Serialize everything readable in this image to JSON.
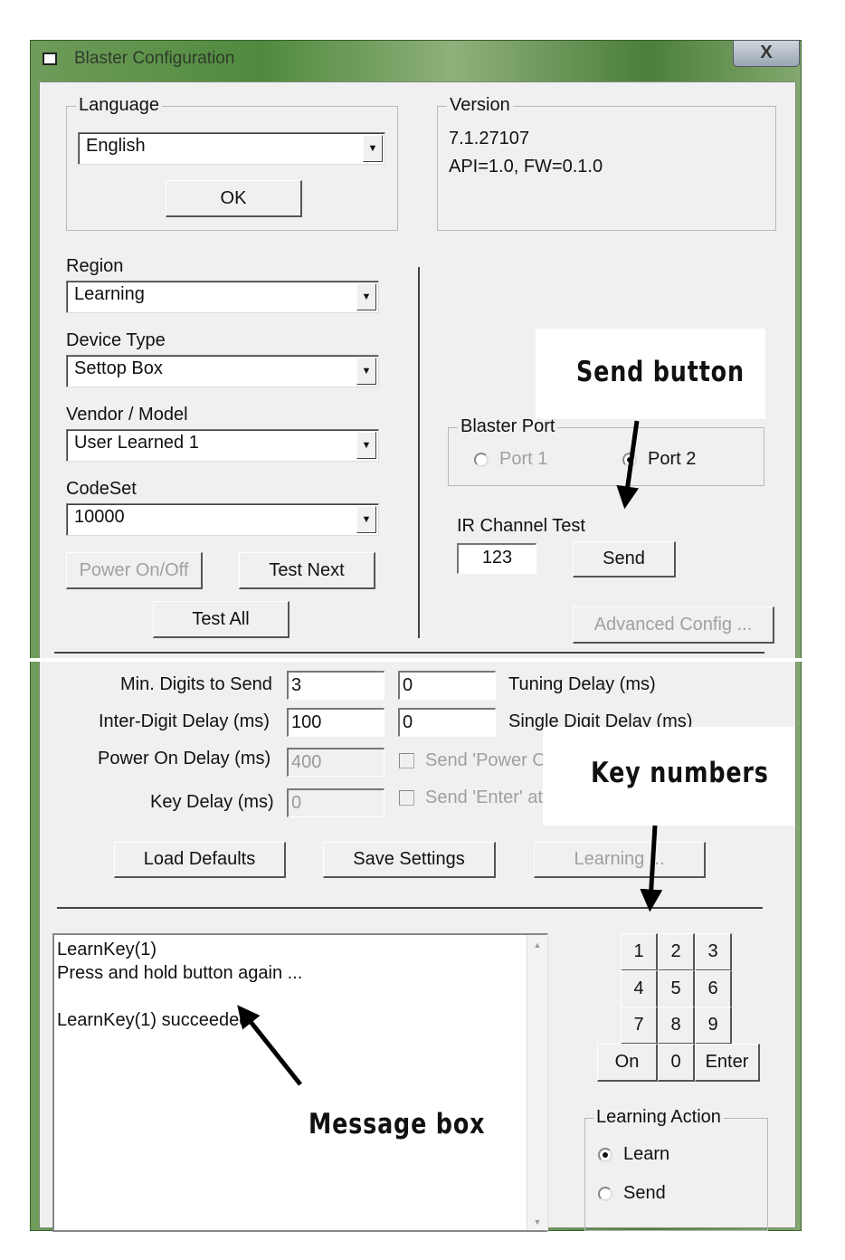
{
  "window": {
    "title": "Blaster Configuration",
    "close_label": "X"
  },
  "language": {
    "group_label": "Language",
    "selected": "English",
    "ok_label": "OK"
  },
  "version": {
    "group_label": "Version",
    "line1": "7.1.27107",
    "line2": "API=1.0, FW=0.1.0"
  },
  "region": {
    "label": "Region",
    "selected": "Learning"
  },
  "device_type": {
    "label": "Device Type",
    "selected": "Settop Box"
  },
  "vendor_model": {
    "label": "Vendor / Model",
    "selected": "User Learned 1"
  },
  "codeset": {
    "label": "CodeSet",
    "selected": "10000"
  },
  "buttons": {
    "power": "Power On/Off",
    "test_next": "Test Next",
    "test_all": "Test All",
    "advanced": "Advanced Config ...",
    "load_defaults": "Load Defaults",
    "save_settings": "Save Settings",
    "learning": "Learning ..."
  },
  "blaster_port": {
    "group_label": "Blaster Port",
    "port1": "Port 1",
    "port2": "Port 2",
    "selected": "Port 2"
  },
  "ir_test": {
    "label": "IR Channel Test",
    "value": "123",
    "send_label": "Send"
  },
  "settings": {
    "min_digits": {
      "label": "Min. Digits to Send",
      "value": "3"
    },
    "inter_digit": {
      "label": "Inter-Digit Delay (ms)",
      "value": "100"
    },
    "power_on_delay": {
      "label": "Power On Delay (ms)",
      "value": "400"
    },
    "key_delay": {
      "label": "Key Delay (ms)",
      "value": "0"
    },
    "tuning_delay": {
      "label": "Tuning Delay (ms)",
      "value": "0"
    },
    "single_digit": {
      "label": "Single Digit Delay (ms)",
      "value": "0"
    },
    "send_power": {
      "label": "Send 'Power O",
      "checked": false
    },
    "send_enter": {
      "label": "Send 'Enter' at",
      "checked": false
    }
  },
  "message_box": {
    "text": "LearnKey(1)\nPress and hold button again ...\n\nLearnKey(1) succeeded"
  },
  "keypad": {
    "keys": [
      "1",
      "2",
      "3",
      "4",
      "5",
      "6",
      "7",
      "8",
      "9",
      "On",
      "0",
      "Enter"
    ]
  },
  "learning_action": {
    "group_label": "Learning Action",
    "learn": "Learn",
    "send": "Send",
    "selected": "Learn"
  },
  "annotations": {
    "send_button": "Send button",
    "key_numbers": "Key numbers",
    "message_box": "Message box"
  }
}
